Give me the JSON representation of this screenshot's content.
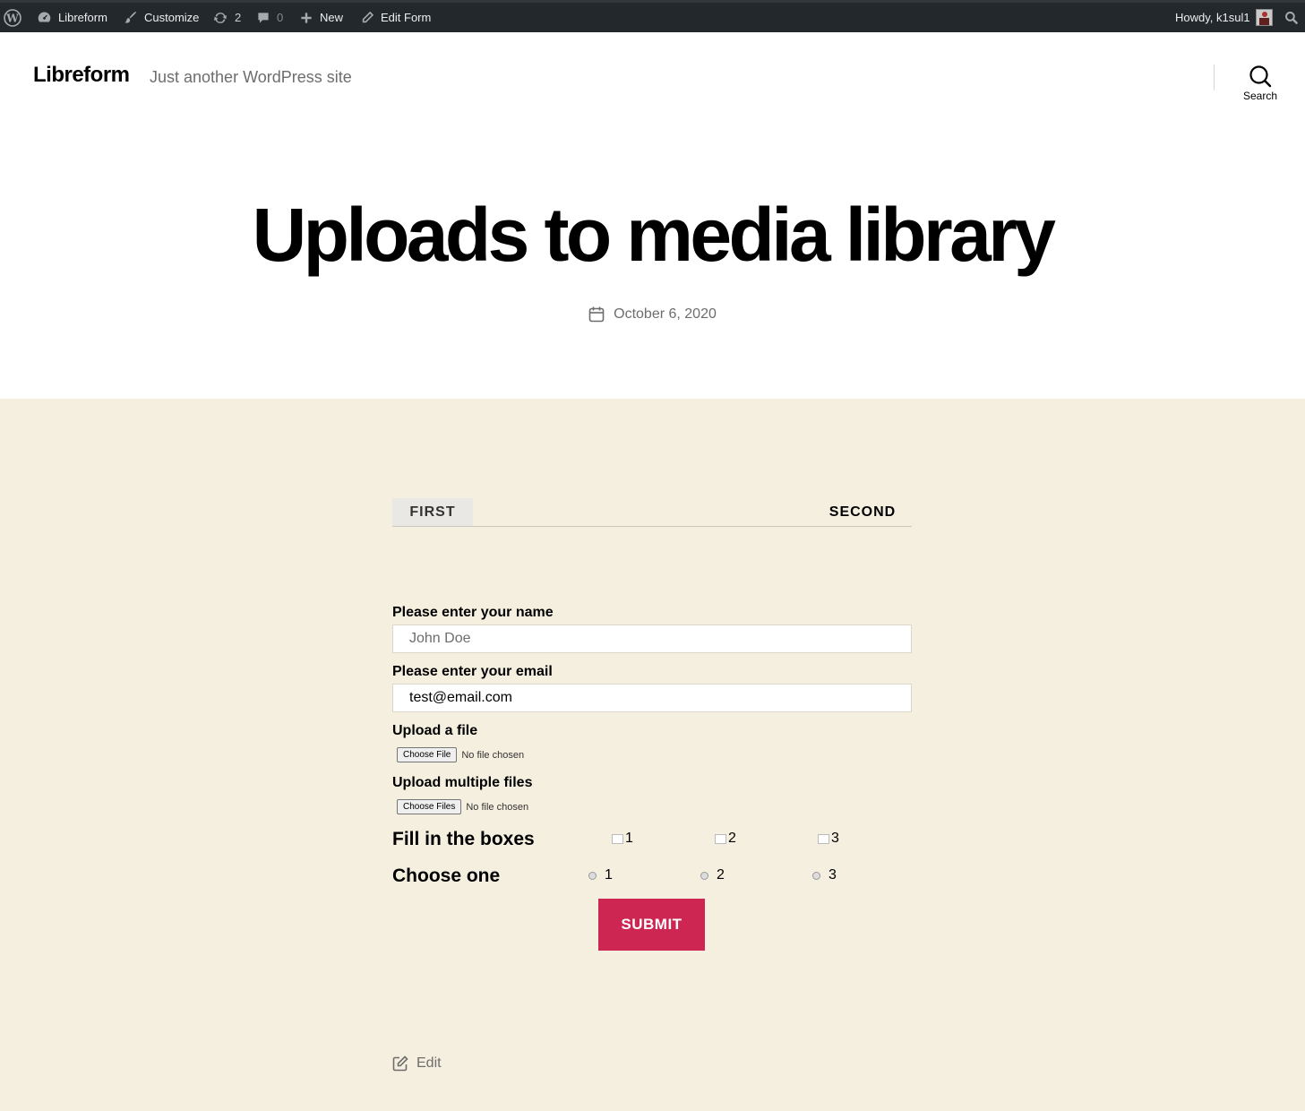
{
  "adminbar": {
    "site_label": "Libreform",
    "customize_label": "Customize",
    "updates_count": "2",
    "comments_count": "0",
    "new_label": "New",
    "edit_label": "Edit Form",
    "howdy_label": "Howdy, k1sul1"
  },
  "header": {
    "site_title": "Libreform",
    "site_description": "Just another WordPress site",
    "search_label": "Search"
  },
  "post": {
    "title": "Uploads to media library",
    "date": "October 6, 2020"
  },
  "form": {
    "tabs": [
      "FIRST",
      "SECOND"
    ],
    "name_label": "Please enter your name",
    "name_placeholder": "John Doe",
    "email_label": "Please enter your email",
    "email_value": "test@email.com",
    "file_label": "Upload a file",
    "file_button": "Choose File",
    "file_status": "No file chosen",
    "multi_label": "Upload multiple files",
    "multi_button": "Choose Files",
    "multi_status": "No file chosen",
    "boxes_label": "Fill in the boxes",
    "boxes_options": [
      "1",
      "2",
      "3"
    ],
    "choose_label": "Choose one",
    "choose_options": [
      "1",
      "2",
      "3"
    ],
    "submit_label": "SUBMIT"
  },
  "footer": {
    "edit_label": "Edit"
  },
  "colors": {
    "adminbar_bg": "#23282d",
    "content_bg": "#f5efe0",
    "accent": "#cd2653",
    "muted_text": "#6d6d6d"
  }
}
